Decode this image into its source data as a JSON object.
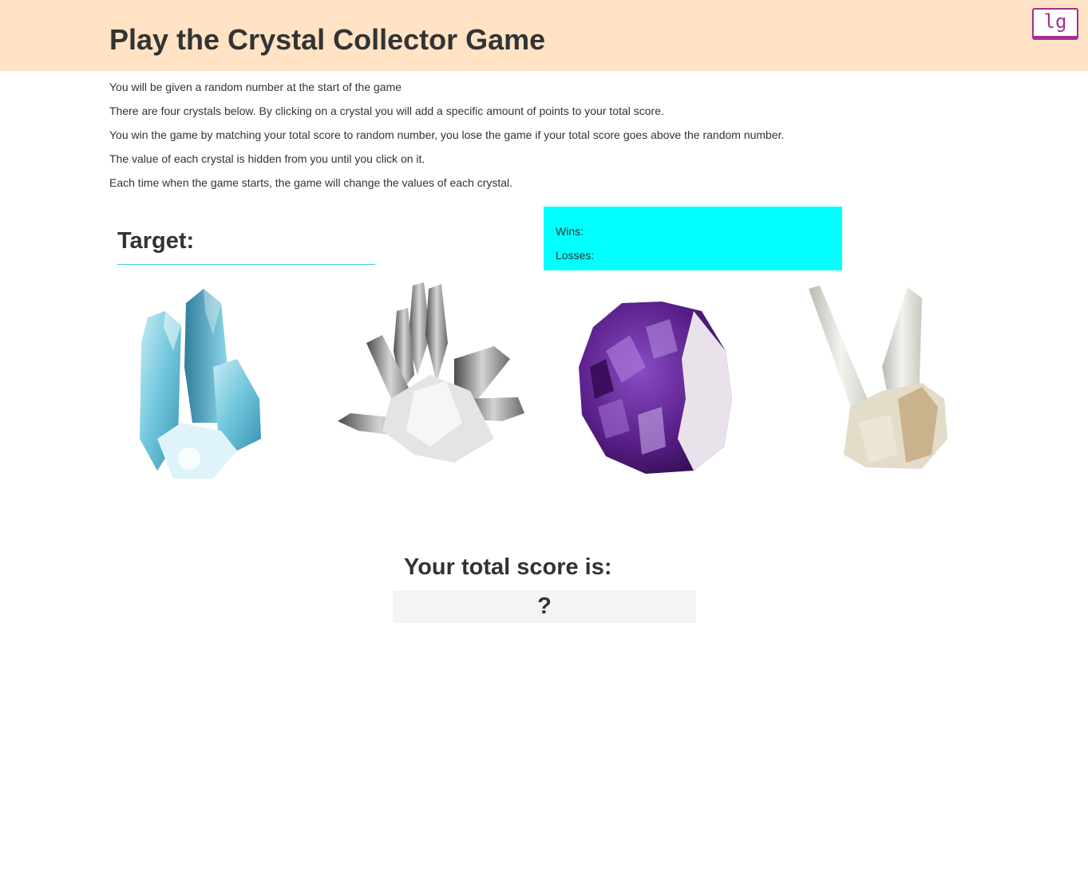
{
  "header": {
    "title": "Play the Crystal Collector Game",
    "badge_label": "lg"
  },
  "instructions": [
    "You will be given a random number at the start of the game",
    "There are four crystals below. By clicking on a crystal you will add a specific amount of points to your total score.",
    "You win the game by matching your total score to random number, you lose the game if your total score goes above the random number.",
    "The value of each crystal is hidden from you until you click on it.",
    "Each time when the game starts, the game will change the values of each crystal."
  ],
  "target": {
    "label": "Target:",
    "value": ""
  },
  "stats": {
    "wins_label": "Wins:",
    "wins_value": "",
    "losses_label": "Losses:",
    "losses_value": ""
  },
  "crystals": [
    {
      "name": "blue-aura-quartz",
      "color": "#6fc6dc"
    },
    {
      "name": "clear-quartz-cluster",
      "color": "#9a9a9a"
    },
    {
      "name": "amethyst-geode",
      "color": "#6a2c9a"
    },
    {
      "name": "quartz-points",
      "color": "#d9d6c4"
    }
  ],
  "score": {
    "label": "Your total score is:",
    "value": "?"
  }
}
